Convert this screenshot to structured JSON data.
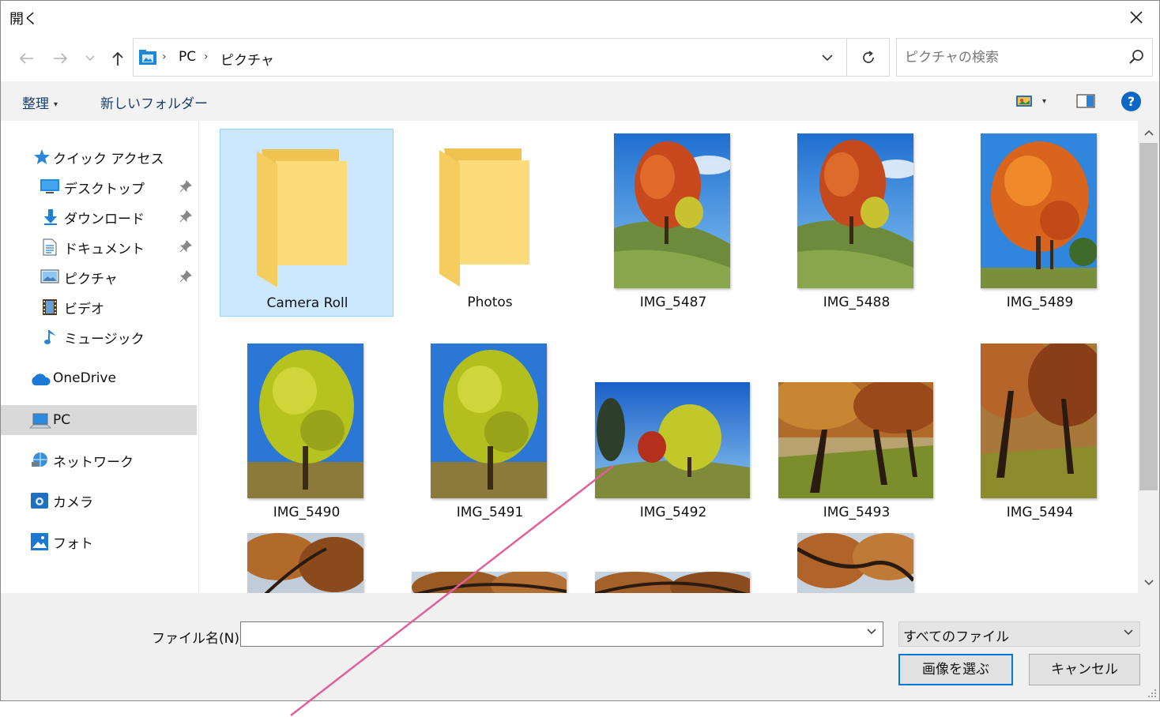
{
  "window": {
    "title": "開く"
  },
  "address": {
    "crumbs": [
      "PC",
      "ピクチャ"
    ]
  },
  "search": {
    "placeholder": "ピクチャの検索"
  },
  "toolbar": {
    "organize_label": "整理",
    "new_folder_label": "新しいフォルダー",
    "help_label": "?"
  },
  "sidebar": {
    "quick_access": {
      "label": "クイック アクセス",
      "icon": "star-icon"
    },
    "pinned": [
      {
        "label": "デスクトップ",
        "icon": "desktop-icon"
      },
      {
        "label": "ダウンロード",
        "icon": "download-icon"
      },
      {
        "label": "ドキュメント",
        "icon": "document-icon"
      },
      {
        "label": "ピクチャ",
        "icon": "pictures-icon"
      }
    ],
    "unpinned": [
      {
        "label": "ビデオ",
        "icon": "video-icon"
      },
      {
        "label": "ミュージック",
        "icon": "music-icon"
      }
    ],
    "onedrive": {
      "label": "OneDrive",
      "icon": "cloud-icon"
    },
    "pc": {
      "label": "PC",
      "icon": "pc-icon",
      "selected": true
    },
    "network": {
      "label": "ネットワーク",
      "icon": "network-icon"
    },
    "camera": {
      "label": "カメラ",
      "icon": "camera-icon"
    },
    "photos": {
      "label": "フォト",
      "icon": "photos-icon"
    }
  },
  "files": {
    "folders": [
      {
        "name": "Camera Roll",
        "selected": true
      },
      {
        "name": "Photos",
        "selected": false
      }
    ],
    "images": [
      {
        "name": "IMG_5487",
        "scene": "red maple tree on grassy hill, blue sky"
      },
      {
        "name": "IMG_5488",
        "scene": "red maple tree on grassy hill, blue sky"
      },
      {
        "name": "IMG_5489",
        "scene": "orange tree, blue sky"
      },
      {
        "name": "IMG_5490",
        "scene": "yellow ginkgo tree"
      },
      {
        "name": "IMG_5491",
        "scene": "yellow ginkgo tree"
      },
      {
        "name": "IMG_5492",
        "scene": "wide view of yellow tree"
      },
      {
        "name": "IMG_5493",
        "scene": "autumn tree-lined avenue"
      },
      {
        "name": "IMG_5494",
        "scene": "autumn tree-lined avenue"
      }
    ]
  },
  "footer": {
    "filename_label": "ファイル名(N):",
    "filename_value": "",
    "filetype_value": "すべてのファイル",
    "open_button": "画像を選ぶ",
    "cancel_button": "キャンセル"
  },
  "colors": {
    "selection": "#cce8ff",
    "accent": "#0078d7",
    "annotation_line": "#e0609a",
    "folder": "#f8d775"
  }
}
